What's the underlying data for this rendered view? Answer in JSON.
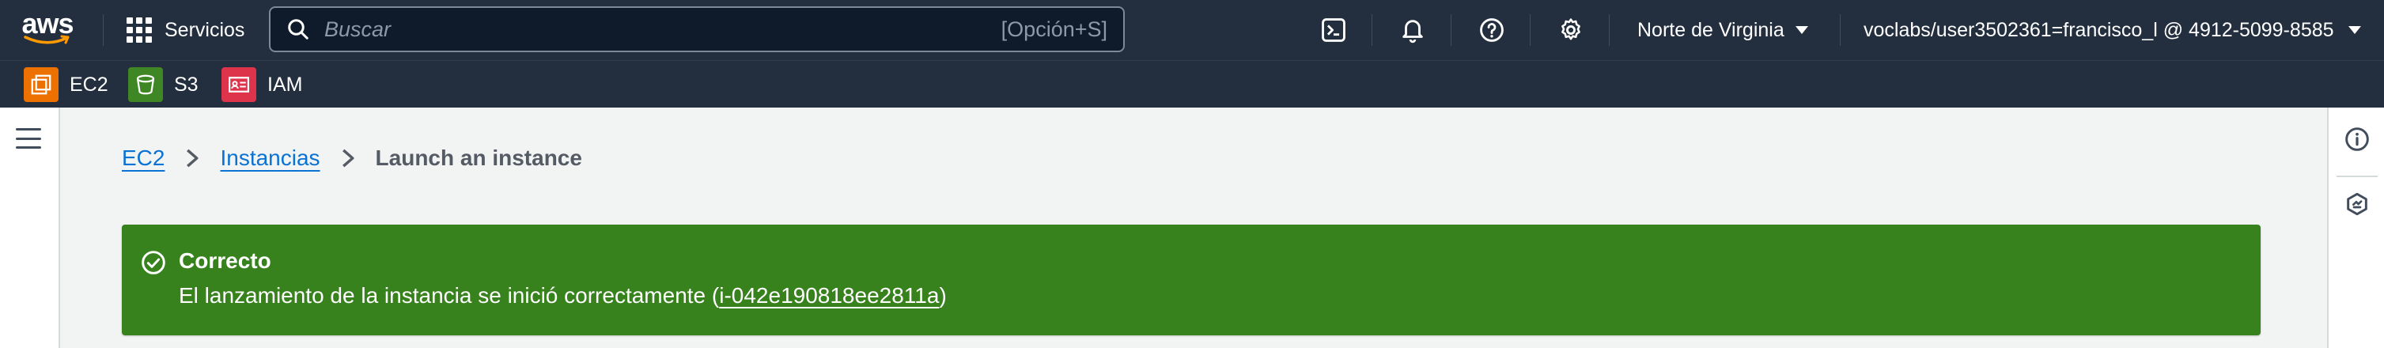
{
  "nav": {
    "logo_text": "aws",
    "services_label": "Servicios",
    "search_placeholder": "Buscar",
    "search_shortcut": "[Opción+S]",
    "region_label": "Norte de Virginia",
    "account_label": "voclabs/user3502361=francisco_l @ 4912-5099-8585",
    "icons": [
      "cloudshell-icon",
      "bell-icon",
      "help-icon",
      "gear-icon"
    ]
  },
  "favorites": [
    {
      "label": "EC2",
      "color": "#ed7100",
      "icon": "ec2-icon"
    },
    {
      "label": "S3",
      "color": "#3f8624",
      "icon": "s3-icon"
    },
    {
      "label": "IAM",
      "color": "#dd344c",
      "icon": "iam-icon"
    }
  ],
  "breadcrumb": {
    "items": [
      "EC2",
      "Instancias"
    ],
    "current": "Launch an instance"
  },
  "flash": {
    "title": "Correcto",
    "message_prefix": "El lanzamiento de la instancia se inició correctamente (",
    "instance_id": "i-042e190818ee2811a",
    "message_suffix": ")",
    "color": "#37821c"
  },
  "colors": {
    "nav_bg": "#232f3e",
    "page_bg": "#f2f3f3",
    "link": "#0972d3",
    "success": "#37821c"
  }
}
